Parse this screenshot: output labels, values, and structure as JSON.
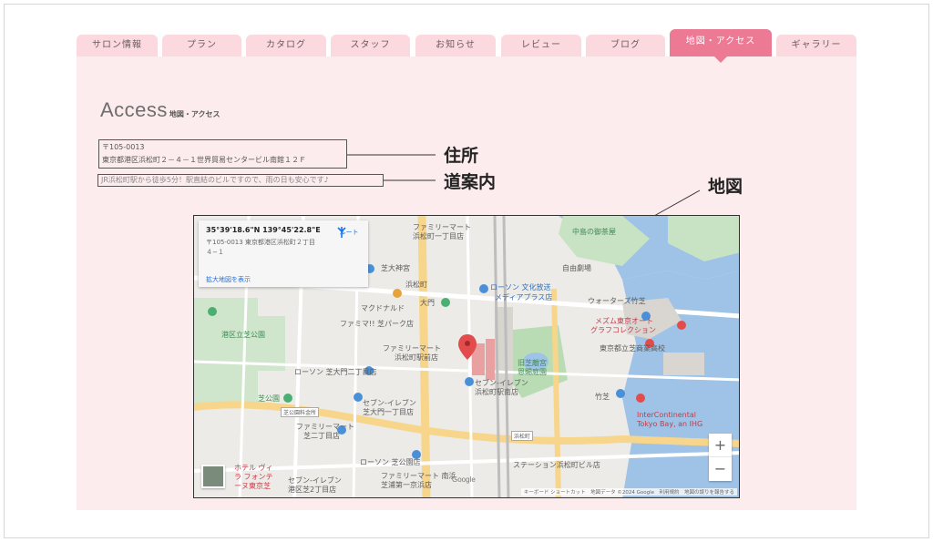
{
  "tabs": [
    {
      "label": "サロン情報",
      "active": false
    },
    {
      "label": "プラン",
      "active": false
    },
    {
      "label": "カタログ",
      "active": false
    },
    {
      "label": "スタッフ",
      "active": false
    },
    {
      "label": "お知らせ",
      "active": false
    },
    {
      "label": "レビュー",
      "active": false
    },
    {
      "label": "ブログ",
      "active": false
    },
    {
      "label": "地図・アクセス",
      "active": true
    },
    {
      "label": "ギャラリー",
      "active": false
    }
  ],
  "heading": {
    "title": "Access",
    "subtitle": "地図・アクセス"
  },
  "address": {
    "postal": "〒105-0013",
    "line": "東京都港区浜松町２－４－１世界貿易センタービル南館１２Ｆ"
  },
  "guide": "JR浜松町駅から徒歩5分！駅直結のビルですので、雨の日も安心です♪",
  "callouts": {
    "address": "住所",
    "guide": "道案内",
    "map": "地図"
  },
  "map": {
    "info_card": {
      "coords": "35°39'18.6\"N 139°45'22.8\"E",
      "address": "〒105-0013 東京都港区浜松町２丁目４−１",
      "larger_map_link": "拡大地図を表示",
      "route_label": "ルート"
    },
    "labels": {
      "family_mart_1": "ファミリーマート",
      "family_mart_1b": "浜松町一丁目店",
      "shiba_daijingu": "芝大神宮",
      "hamamatsucho": "浜松町",
      "daimon": "大門",
      "mcdonalds": "マクドナルド",
      "family_mart_2": "ファミマ!! 芝パーク店",
      "family_mart_3": "ファミリーマート",
      "family_mart_3b": "浜松町駅前店",
      "lawson_1": "ローソン 文化放送",
      "lawson_1b": "メディアプラス店",
      "lawson_2": "ローソン 芝大門二丁目店",
      "seven_eleven_1": "セブン-イレブン",
      "seven_eleven_1b": "芝大門一丁目店",
      "seven_eleven_2": "セブン-イレブン",
      "seven_eleven_2b": "浜松町駅南店",
      "family_mart_4": "ファミリーマート",
      "family_mart_4b": "芝二丁目店",
      "lawson_3": "ローソン 芝公園店",
      "family_mart_5": "ファミリーマート 南浜",
      "family_mart_5b": "芝浦第一京浜店",
      "seven_eleven_3": "セブン-イレブン",
      "seven_eleven_3b": "港区芝2丁目店",
      "hotel_villa_fontaine": "ホテル ヴィラ フォンテーヌ東京芝",
      "chuo_no_komakoro": "中島の御茶屋",
      "jiyu_gekijo": "自由劇場",
      "waters_takeshiba": "ウォーターズ竹芝",
      "mezzo_auto": "メズム東京オート",
      "mezzo_auto_b": "グラフコレクション",
      "toshi_hotel": "東京都立芝商業高校",
      "hamarikyu": "旧芝離宮",
      "hamarikyu_b": "恩賜庭園",
      "takeshiba": "竹芝",
      "intercontinental": "InterContinental",
      "intercontinental_b": "Tokyo Bay, an IHG",
      "shiba_park": "港区立芝公園",
      "shiba_park_2": "芝公園",
      "shiba_koen_st": "芝公園料金所",
      "stemma_hamamatsucho": "ステーション浜松町ビル店",
      "hamamatsucho_st": "浜松町",
      "yugami_ryo": "三井ビル"
    },
    "attribution": "キーボード ショートカット　地図データ ©2024 Google　利用規約　地図の誤りを報告する",
    "google_logo": "Google",
    "zoom_in": "+",
    "zoom_out": "−"
  }
}
